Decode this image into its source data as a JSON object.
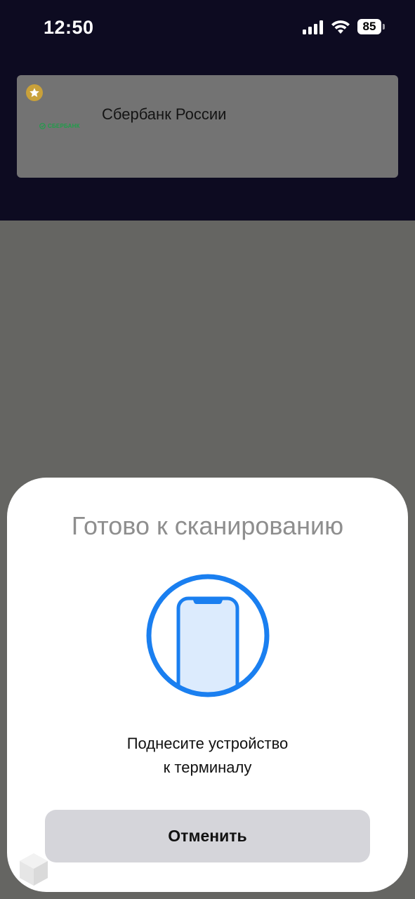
{
  "status_bar": {
    "time": "12:50",
    "battery_level": "85",
    "icons": [
      "signal-icon",
      "wifi-icon",
      "battery-icon"
    ]
  },
  "card": {
    "bank_name": "Сбербанк России",
    "logo_text": "СБЕРБАНК",
    "favorite_icon": "star-icon",
    "colors": {
      "logo_green": "#1f9e4a",
      "star_badge": "#c9a13a"
    }
  },
  "sheet": {
    "title": "Готово к сканированию",
    "icon": "phone-scan-icon",
    "message_line1": "Поднесите устройство",
    "message_line2": "к терминалу",
    "cancel_label": "Отменить",
    "accent_color": "#1a7ff0"
  }
}
